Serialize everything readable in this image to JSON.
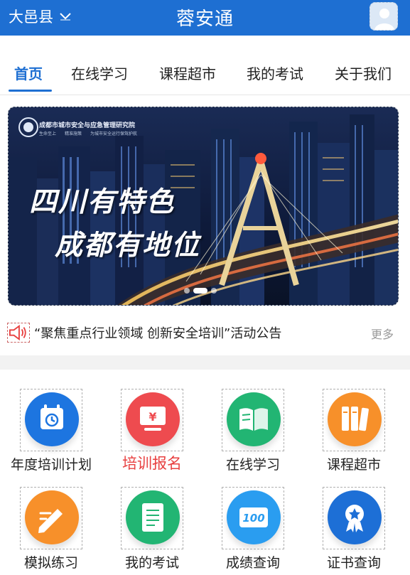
{
  "header": {
    "region": "大邑县",
    "title": "蓉安通"
  },
  "tabs": [
    {
      "label": "首页",
      "active": true
    },
    {
      "label": "在线学习",
      "active": false
    },
    {
      "label": "课程超市",
      "active": false
    },
    {
      "label": "我的考试",
      "active": false
    },
    {
      "label": "关于我们",
      "active": false
    }
  ],
  "banner": {
    "org_name": "成都市城市安全与应急管理研究院",
    "slogan": "生命至上　　精准施策　　为城市安全运行保驾护航",
    "line1": "四川有特色",
    "line2": "成都有地位",
    "slide_count": 3,
    "active_slide": 2
  },
  "notice": {
    "text": "“聚焦重点行业领域 创新安全培训”活动公告",
    "more": "更多"
  },
  "grid": [
    {
      "label": "年度培训计划",
      "icon": "calendar-clock-icon",
      "color": "#1d75e0"
    },
    {
      "label": "培训报名",
      "icon": "yen-monitor-icon",
      "color": "#ee4b4f",
      "highlight": true
    },
    {
      "label": "在线学习",
      "icon": "open-book-icon",
      "color": "#22b573"
    },
    {
      "label": "课程超市",
      "icon": "books-icon",
      "color": "#f7902a"
    },
    {
      "label": "模拟练习",
      "icon": "pencil-note-icon",
      "color": "#f7902a"
    },
    {
      "label": "我的考试",
      "icon": "scroll-document-icon",
      "color": "#22b573"
    },
    {
      "label": "成绩查询",
      "icon": "score-100-icon",
      "color": "#2a9df0"
    },
    {
      "label": "证书查询",
      "icon": "award-badge-icon",
      "color": "#1d6fd6"
    }
  ]
}
